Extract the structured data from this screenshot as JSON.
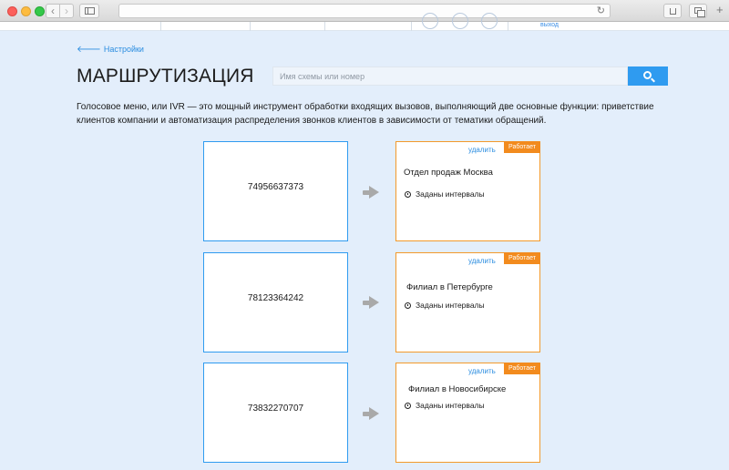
{
  "page": {
    "back_link": "Настройки",
    "title": "МАРШРУТИЗАЦИЯ",
    "search": {
      "placeholder": "Имя схемы или номер"
    },
    "description": "Голосовое меню, или IVR — это мощный инструмент обработки входящих вызовов, выполняющий две основные функции: приветствие клиентов компании и автоматизация распределения звонков клиентов в зависимости от тематики обращений.",
    "exit_label": "выход"
  },
  "routes": [
    {
      "number": "74956637373",
      "scheme": "Отдел продаж Москва",
      "status": "Работает",
      "delete": "удалить",
      "schedule": "Заданы интервалы"
    },
    {
      "number": "78123364242",
      "scheme": "Филиал в Петербурге",
      "status": "Работает",
      "delete": "удалить",
      "schedule": "Заданы интервалы"
    },
    {
      "number": "73832270707",
      "scheme": "Филиал в Новосибирске",
      "status": "Работает",
      "delete": "удалить",
      "schedule": "Заданы интервалы"
    }
  ],
  "colors": {
    "accent": "#2f9bf0",
    "status": "#f28b1e",
    "ivr_border": "#f39a2b"
  },
  "icons": {
    "back": "arrow-left-icon",
    "search": "search-icon",
    "arrow": "arrow-right-icon",
    "schedule": "clock-icon"
  }
}
